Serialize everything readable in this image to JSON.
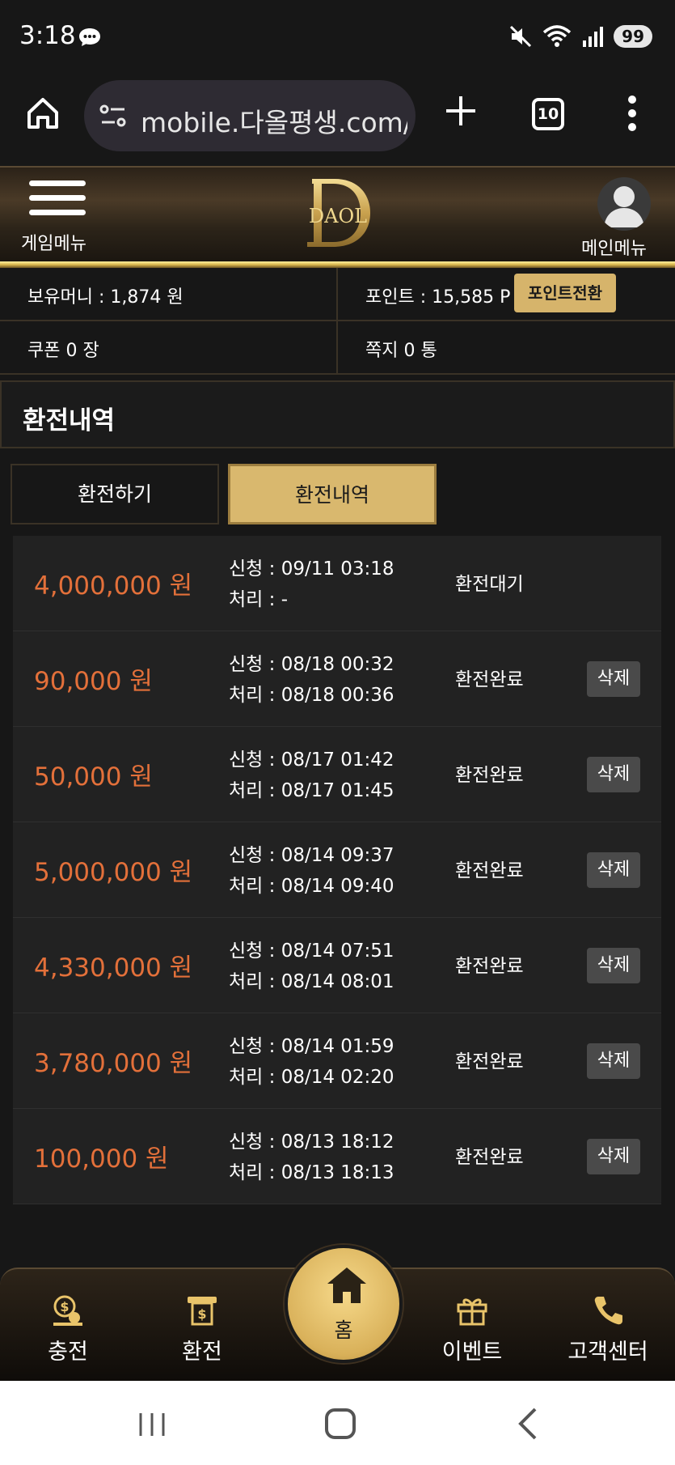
{
  "status_bar": {
    "time": "3:18",
    "battery": "99"
  },
  "browser": {
    "url": "mobile.다올평생.com/",
    "tab_count": "10"
  },
  "header": {
    "game_menu_label": "게임메뉴",
    "logo_text": "DAOL",
    "main_menu_label": "메인메뉴"
  },
  "info": {
    "money": "보유머니 : 1,874 원",
    "point": "포인트 : 15,585 P",
    "point_convert_label": "포인트전환",
    "coupon": "쿠폰 0 장",
    "message": "쪽지 0 통"
  },
  "section": {
    "title": "환전내역"
  },
  "tabs": [
    {
      "label": "환전하기"
    },
    {
      "label": "환전내역"
    }
  ],
  "delete_label": "삭제",
  "history": [
    {
      "amount": "4,000,000 원",
      "requested": "신청 : 09/11 03:18",
      "processed": "처리 : -",
      "status": "환전대기"
    },
    {
      "amount": "90,000 원",
      "requested": "신청 : 08/18 00:32",
      "processed": "처리 : 08/18 00:36",
      "status": "환전완료"
    },
    {
      "amount": "50,000 원",
      "requested": "신청 : 08/17 01:42",
      "processed": "처리 : 08/17 01:45",
      "status": "환전완료"
    },
    {
      "amount": "5,000,000 원",
      "requested": "신청 : 08/14 09:37",
      "processed": "처리 : 08/14 09:40",
      "status": "환전완료"
    },
    {
      "amount": "4,330,000 원",
      "requested": "신청 : 08/14 07:51",
      "processed": "처리 : 08/14 08:01",
      "status": "환전완료"
    },
    {
      "amount": "3,780,000 원",
      "requested": "신청 : 08/14 01:59",
      "processed": "처리 : 08/14 02:20",
      "status": "환전완료"
    },
    {
      "amount": "100,000 원",
      "requested": "신청 : 08/13 18:12",
      "processed": "처리 : 08/13 18:13",
      "status": "환전완료"
    }
  ],
  "bottom_nav": {
    "charge": "충전",
    "exchange": "환전",
    "home": "홈",
    "event": "이벤트",
    "support": "고객센터"
  },
  "colors": {
    "accent_gold": "#d9b86e",
    "amount_orange": "#e3703a"
  }
}
